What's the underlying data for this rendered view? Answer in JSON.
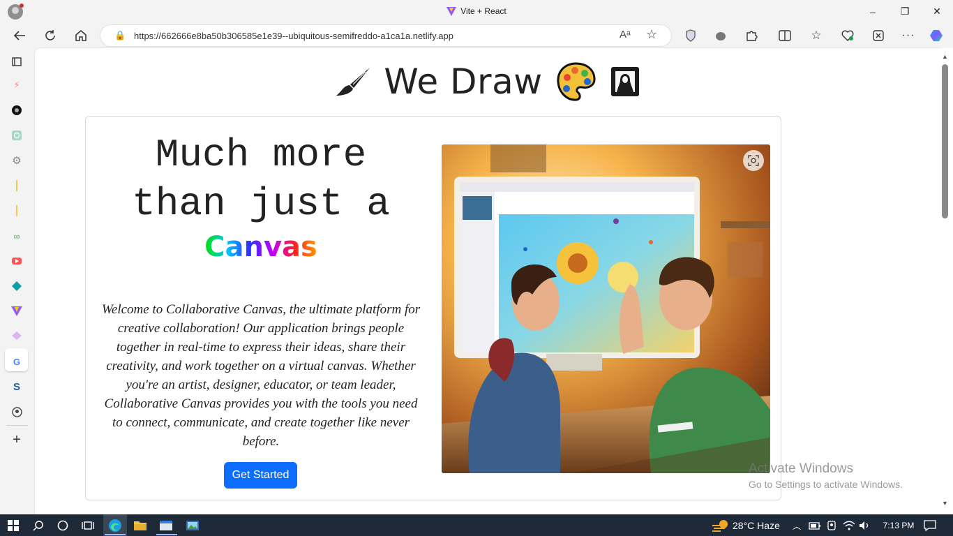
{
  "window": {
    "title": "Vite + React",
    "controls": {
      "minimize": "–",
      "restore": "❐",
      "close": "✕"
    }
  },
  "browser": {
    "url": "https://662666e8ba50b306585e1e39--ubiquitous-semifreddo-a1ca1a.netlify.app",
    "read_aloud_icon": "Aᵃ",
    "toolbar_icons": [
      "back-icon",
      "refresh-icon",
      "home-icon",
      "read-aloud-icon",
      "favorite-icon",
      "shield-icon",
      "extension-icon",
      "puzzle-icon",
      "split-screen-icon",
      "favorites-icon",
      "health-icon",
      "screenshot-icon",
      "more-icon",
      "copilot-icon"
    ]
  },
  "sidebar": {
    "items": [
      "tabs-icon",
      "app-icon",
      "ai-icon",
      "openai-icon",
      "settings-icon",
      "vite-icon",
      "vite-icon",
      "infinity-icon",
      "youtube-icon",
      "diamond-icon",
      "vite-icon",
      "layers-icon",
      "google-icon",
      "s-icon",
      "github-icon",
      "add-icon"
    ],
    "s_label": "S",
    "g_label": "G",
    "add_label": "+"
  },
  "page": {
    "title": "We Draw",
    "headline_1": "Much more",
    "headline_2": "than just a",
    "canvas_word": "Canvas",
    "description": "Welcome to Collaborative Canvas, the ultimate platform for creative collaboration! Our application brings people together in real-time to express their ideas, share their creativity, and work together on a virtual canvas. Whether you're an artist, designer, educator, or team leader, Collaborative Canvas provides you with the tools you need to connect, communicate, and create together like never before.",
    "button": "Get Started",
    "hero_alt": "illustration"
  },
  "watermark": {
    "line1": "Activate Windows",
    "line2": "Go to Settings to activate Windows."
  },
  "taskbar": {
    "weather": "28°C  Haze",
    "time": "7:13 PM"
  }
}
